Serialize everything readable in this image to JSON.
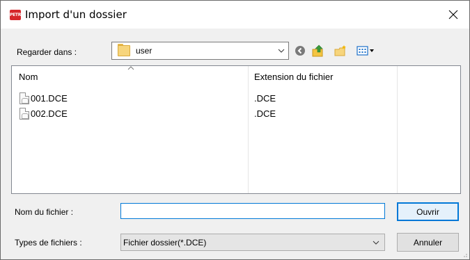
{
  "window": {
    "title": "Import d'un dossier",
    "app_icon_text": "PETRA",
    "brand_color": "#d6262b"
  },
  "lookin": {
    "label": "Regarder dans :",
    "value": "user"
  },
  "toolbar": {
    "icons": [
      "back-icon",
      "up-folder-icon",
      "new-folder-icon",
      "view-menu-icon"
    ]
  },
  "filelist": {
    "columns": [
      "Nom",
      "Extension du fichier"
    ],
    "rows": [
      {
        "name": "001.DCE",
        "ext": ".DCE"
      },
      {
        "name": "002.DCE",
        "ext": ".DCE"
      }
    ]
  },
  "filename": {
    "label": "Nom du fichier :",
    "value": ""
  },
  "filetype": {
    "label": "Types de fichiers :",
    "value": "Fichier dossier(*.DCE)"
  },
  "buttons": {
    "open": "Ouvrir",
    "cancel": "Annuler"
  },
  "colors": {
    "accent": "#0078d7",
    "dialog_bg": "#f0f0f0"
  }
}
